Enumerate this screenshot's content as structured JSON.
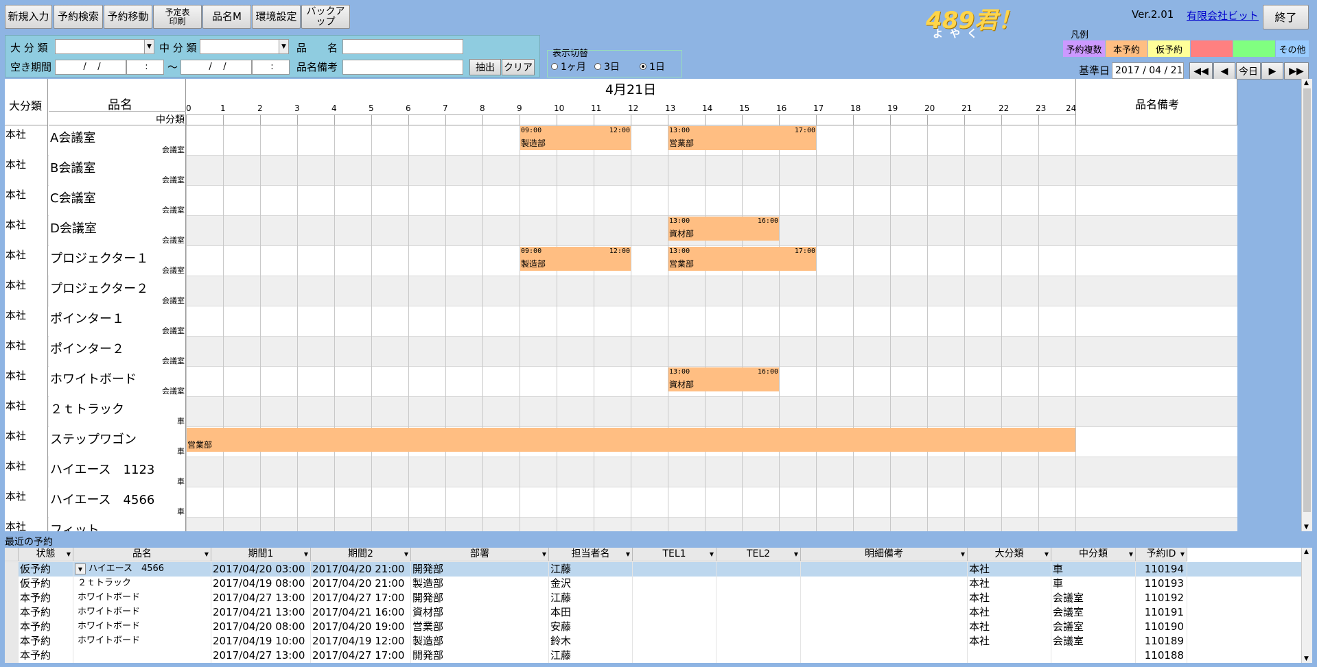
{
  "toolbar": {
    "new_entry": "新規入力",
    "reservation_search": "予約検索",
    "reservation_move": "予約移動",
    "print_schedule": "予定表\n印刷",
    "item_master": "品名M",
    "settings": "環境設定",
    "backup": "バックアップ",
    "exit": "終了"
  },
  "app": {
    "logo": "489君！",
    "logo_sub": "よやく",
    "version": "Ver.2.01",
    "company": "有限会社ビット"
  },
  "filter": {
    "major_label": "大 分 類",
    "middle_label": "中 分 類",
    "item_label": "品　　名",
    "period_label": "空き期間",
    "period_from": "/    /",
    "period_from_time": ":",
    "tilde": "～",
    "period_to": "/    /",
    "period_to_time": ":",
    "note_label": "品名備考",
    "extract_button": "抽出",
    "clear_button": "クリア"
  },
  "display_switch": {
    "title": "表示切替",
    "options": [
      "1ヶ月",
      "3日",
      "1日"
    ],
    "selected": "1日"
  },
  "legend": {
    "title": "凡例",
    "items": [
      {
        "label": "予約複数",
        "color": "#CC99FF"
      },
      {
        "label": "本予約",
        "color": "#FFBE82"
      },
      {
        "label": "仮予約",
        "color": "#FFFF99"
      },
      {
        "label": "",
        "color": "#FF8080"
      },
      {
        "label": "",
        "color": "#80FF80"
      },
      {
        "label": "その他",
        "color": "#99CCFF"
      }
    ]
  },
  "date_nav": {
    "label": "基準日",
    "value": "2017 / 04 / 21",
    "prev_prev": "◀◀",
    "prev": "◀",
    "today": "今日",
    "next": "▶",
    "next_next": "▶▶"
  },
  "grid": {
    "header_major": "大分類",
    "header_item": "品名",
    "header_middle": "中分類",
    "header_note": "品名備考",
    "date_title": "4月21日",
    "hours": [
      "0",
      "1",
      "2",
      "3",
      "4",
      "5",
      "6",
      "7",
      "8",
      "9",
      "10",
      "11",
      "12",
      "13",
      "14",
      "15",
      "16",
      "17",
      "18",
      "19",
      "20",
      "21",
      "22",
      "23",
      "24"
    ],
    "rows": [
      {
        "major": "本社",
        "name": "A会議室",
        "middle": "会議室",
        "bookings": [
          {
            "start": 9,
            "end": 12,
            "start_label": "09:00",
            "end_label": "12:00",
            "dept": "製造部"
          },
          {
            "start": 13,
            "end": 17,
            "start_label": "13:00",
            "end_label": "17:00",
            "dept": "営業部"
          }
        ]
      },
      {
        "major": "本社",
        "name": "B会議室",
        "middle": "会議室",
        "bookings": []
      },
      {
        "major": "本社",
        "name": "C会議室",
        "middle": "会議室",
        "bookings": []
      },
      {
        "major": "本社",
        "name": "D会議室",
        "middle": "会議室",
        "bookings": [
          {
            "start": 13,
            "end": 16,
            "start_label": "13:00",
            "end_label": "16:00",
            "dept": "資材部"
          }
        ]
      },
      {
        "major": "本社",
        "name": "プロジェクター１",
        "middle": "会議室",
        "bookings": [
          {
            "start": 9,
            "end": 12,
            "start_label": "09:00",
            "end_label": "12:00",
            "dept": "製造部"
          },
          {
            "start": 13,
            "end": 17,
            "start_label": "13:00",
            "end_label": "17:00",
            "dept": "営業部"
          }
        ]
      },
      {
        "major": "本社",
        "name": "プロジェクター２",
        "middle": "会議室",
        "bookings": []
      },
      {
        "major": "本社",
        "name": "ポインター１",
        "middle": "会議室",
        "bookings": []
      },
      {
        "major": "本社",
        "name": "ポインター２",
        "middle": "会議室",
        "bookings": []
      },
      {
        "major": "本社",
        "name": "ホワイトボード",
        "middle": "会議室",
        "bookings": [
          {
            "start": 13,
            "end": 16,
            "start_label": "13:00",
            "end_label": "16:00",
            "dept": "資材部"
          }
        ]
      },
      {
        "major": "本社",
        "name": "２ｔトラック",
        "middle": "車",
        "bookings": []
      },
      {
        "major": "本社",
        "name": "ステップワゴン",
        "middle": "車",
        "bookings": [
          {
            "start": 0,
            "end": 24,
            "start_label": "",
            "end_label": "",
            "dept": "営業部"
          }
        ]
      },
      {
        "major": "本社",
        "name": "ハイエース　1123",
        "middle": "車",
        "bookings": []
      },
      {
        "major": "本社",
        "name": "ハイエース　4566",
        "middle": "車",
        "bookings": []
      },
      {
        "major": "本社",
        "name": "フィット",
        "middle": "",
        "bookings": []
      }
    ]
  },
  "recent": {
    "title": "最近の予約",
    "columns": [
      "状態",
      "品名",
      "期間1",
      "期間2",
      "部署",
      "担当者名",
      "TEL1",
      "TEL2",
      "明細備考",
      "大分類",
      "中分類",
      "予約ID"
    ],
    "rows": [
      [
        "仮予約",
        "ハイエース　4566",
        "2017/04/20 03:00",
        "2017/04/20 21:00",
        "開発部",
        "江藤",
        "",
        "",
        "",
        "本社",
        "車",
        "110194"
      ],
      [
        "仮予約",
        "２ｔトラック",
        "2017/04/19 08:00",
        "2017/04/20 21:00",
        "製造部",
        "金沢",
        "",
        "",
        "",
        "本社",
        "車",
        "110193"
      ],
      [
        "本予約",
        "ホワイトボード",
        "2017/04/27 13:00",
        "2017/04/27 17:00",
        "開発部",
        "江藤",
        "",
        "",
        "",
        "本社",
        "会議室",
        "110192"
      ],
      [
        "本予約",
        "ホワイトボード",
        "2017/04/21 13:00",
        "2017/04/21 16:00",
        "資材部",
        "本田",
        "",
        "",
        "",
        "本社",
        "会議室",
        "110191"
      ],
      [
        "本予約",
        "ホワイトボード",
        "2017/04/20 08:00",
        "2017/04/20 19:00",
        "営業部",
        "安藤",
        "",
        "",
        "",
        "本社",
        "会議室",
        "110190"
      ],
      [
        "本予約",
        "ホワイトボード",
        "2017/04/19 10:00",
        "2017/04/19 12:00",
        "製造部",
        "鈴木",
        "",
        "",
        "",
        "本社",
        "会議室",
        "110189"
      ],
      [
        "本予約",
        "",
        "2017/04/27 13:00",
        "2017/04/27 17:00",
        "開発部",
        "江藤",
        "",
        "",
        "",
        "",
        "",
        "110188"
      ]
    ]
  }
}
